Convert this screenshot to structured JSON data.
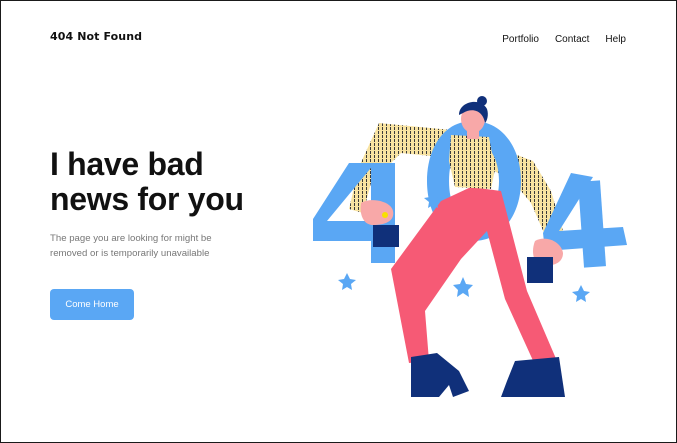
{
  "header": {
    "logo": "404 Not Found",
    "nav": [
      "Portfolio",
      "Contact",
      "Help"
    ]
  },
  "hero": {
    "headline_line1": "I have bad",
    "headline_line2": "news for you",
    "subtitle_line1": "The page you are looking for might be",
    "subtitle_line2": "removed or is temporarily unavailable",
    "button_label": "Come Home"
  },
  "illustration": {
    "icon": "woman-holding-404-illustration",
    "colors": {
      "digits": "#5aa7f4",
      "pants": "#f65a75",
      "sweater": "#f8e3a1",
      "hair_shoes": "#10307a",
      "skin": "#f8a8a8"
    }
  },
  "colors": {
    "accent": "#5aa7f4",
    "text": "#111111",
    "muted": "#777777"
  }
}
